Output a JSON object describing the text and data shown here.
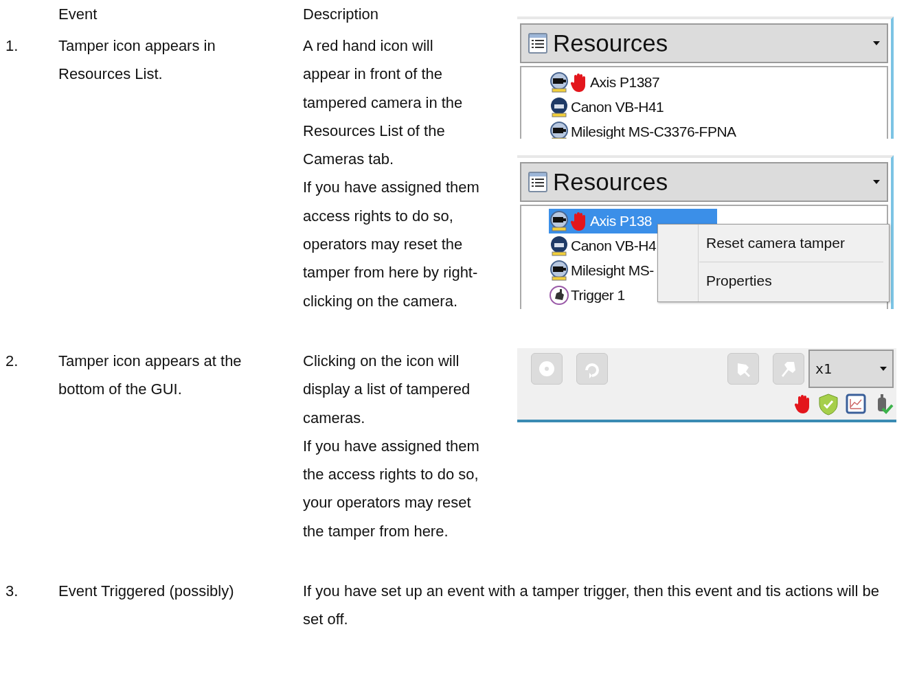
{
  "columns": [
    "Event",
    "Description"
  ],
  "rows": [
    {
      "number": "1.",
      "event": "Tamper icon appears in Resources List.",
      "description": [
        "A red hand icon will appear in front of the tampered camera in the Resources List of the Cameras tab.",
        "If you have assigned them access rights to do so, operators may reset the tamper from here by right- clicking on the camera."
      ],
      "panels": [
        {
          "kind": "resources",
          "title": "Resources",
          "items": [
            {
              "label": "Axis P1387",
              "kind": "camera",
              "tampered": true,
              "selected": false
            },
            {
              "label": "Canon VB-H41",
              "kind": "dome",
              "tampered": false,
              "selected": false
            },
            {
              "label": "Milesight MS-C3376-FPNA",
              "kind": "camera",
              "tampered": false,
              "selected": false
            }
          ]
        },
        {
          "kind": "resources",
          "title": "Resources",
          "items": [
            {
              "label": "Axis P138",
              "kind": "camera",
              "tampered": true,
              "selected": true
            },
            {
              "label": "Canon VB-H4",
              "kind": "dome",
              "tampered": false,
              "selected": false
            },
            {
              "label": "Milesight MS-",
              "kind": "camera",
              "tampered": false,
              "selected": false
            },
            {
              "label": "Trigger 1",
              "kind": "trigger",
              "tampered": false,
              "selected": false
            }
          ],
          "context_menu": [
            "Reset camera tamper",
            "Properties"
          ]
        }
      ]
    },
    {
      "number": "2.",
      "event": "Tamper icon appears at the bottom of the GUI.",
      "description": [
        "Clicking on the icon will display a list of tampered cameras.",
        "If you have assigned them the access rights to do so, your operators may reset the tamper from here."
      ],
      "panels": [
        {
          "kind": "toolbar",
          "speed": "x1",
          "tampered": true
        }
      ]
    },
    {
      "number": "3.",
      "event": "Event Triggered (possibly)",
      "description": [
        "If you have set up an event with a tamper trigger, then this event and tis actions will be set off."
      ]
    }
  ]
}
